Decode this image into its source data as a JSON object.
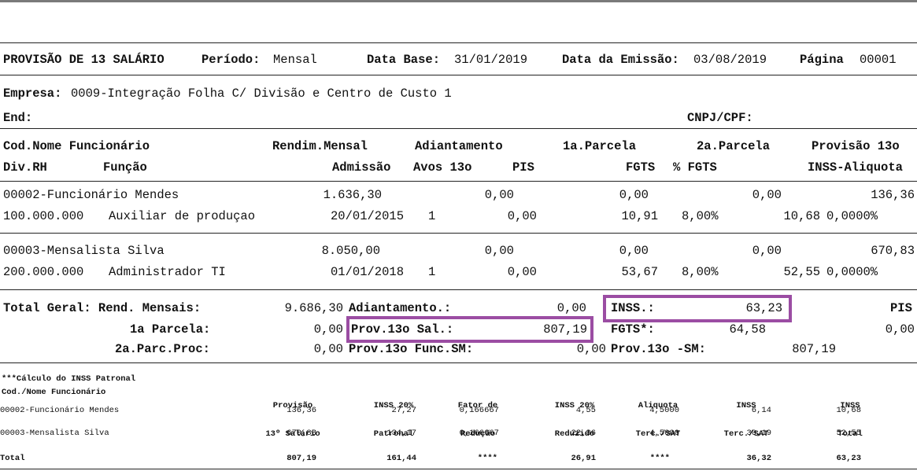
{
  "header": {
    "title": "PROVISÃO DE 13 SALÁRIO",
    "periodo_label": "Período:",
    "periodo_value": "Mensal",
    "data_base_label": "Data Base:",
    "data_base_value": "31/01/2019",
    "emissao_label": "Data da Emissão:",
    "emissao_value": "03/08/2019",
    "pagina_label": "Página",
    "pagina_value": "00001"
  },
  "empresa": {
    "label": "Empresa:",
    "value": "0009-Integração Folha C/ Divisão e Centro de Custo 1",
    "end_label": "End:",
    "cnpj_label": "CNPJ/CPF:"
  },
  "columns": {
    "row1": [
      "Cod.Nome Funcionário",
      "Rendim.Mensal",
      "Adiantamento",
      "1a.Parcela",
      "2a.Parcela",
      "Provisão 13o"
    ],
    "row2": [
      "Div.RH",
      "Função",
      "Admissão",
      "Avos 13o",
      "PIS",
      "FGTS",
      "% FGTS",
      "INSS-Aliquota"
    ]
  },
  "employees": [
    {
      "name": "00002-Funcionário Mendes",
      "rendimento": "1.636,30",
      "adiantamento": "0,00",
      "parcela1": "0,00",
      "parcela2": "0,00",
      "provisao": "136,36",
      "div_rh": "100.000.000",
      "funcao": "Auxiliar de produçao",
      "admissao": "20/01/2015",
      "avos": "1",
      "pis": "0,00",
      "fgts": "10,91",
      "pct_fgts": "8,00%",
      "inss": "10,68",
      "aliquota": "0,0000%"
    },
    {
      "name": "00003-Mensalista Silva",
      "rendimento": "8.050,00",
      "adiantamento": "0,00",
      "parcela1": "0,00",
      "parcela2": "0,00",
      "provisao": "670,83",
      "div_rh": "200.000.000",
      "funcao": "Administrador TI",
      "admissao": "01/01/2018",
      "avos": "1",
      "pis": "0,00",
      "fgts": "53,67",
      "pct_fgts": "8,00%",
      "inss": "52,55",
      "aliquota": "0,0000%"
    }
  ],
  "totals": {
    "rend_label": "Total Geral: Rend. Mensais:",
    "rend_value": "9.686,30",
    "adiant_label": "Adiantamento.:",
    "adiant_value": "0,00",
    "inss_label": "INSS.:",
    "inss_value": "63,23",
    "pis_label": "PIS",
    "parcela1_label": "1a Parcela:",
    "parcela1_value": "0,00",
    "prov_sal_label": "Prov.13o Sal.:",
    "prov_sal_value": "807,19",
    "fgts_label": "FGTS*:",
    "fgts_value": "64,58",
    "pis_value": "0,00",
    "parc2_label": "2a.Parc.Proc:",
    "parc2_value": "0,00",
    "prov_func_label": "Prov.13o Func.SM:",
    "prov_func_value": "0,00",
    "prov_sm_label": "Prov.13o -SM:",
    "prov_sm_value": "807,19"
  },
  "inss_patronal": {
    "title": "***Cálculo do INSS Patronal",
    "name_header": "Cod./Nome Funcionário",
    "headers": [
      [
        "Provisão",
        "13º Salário"
      ],
      [
        "INSS 20%",
        "Patronal"
      ],
      [
        "Fator de",
        "Redução"
      ],
      [
        "INSS 20%",
        "Reduzido"
      ],
      [
        "Aliquota",
        "Terc./SAT"
      ],
      [
        "INSS",
        "Terc./SAT"
      ],
      [
        "INSS",
        "Total"
      ]
    ],
    "rows": [
      {
        "name": "00002-Funcionário Mendes",
        "values": [
          "136,36",
          "27,27",
          "0,166667",
          "4,55",
          "4,5000",
          "6,14",
          "10,68"
        ]
      },
      {
        "name": "00003-Mensalista Silva",
        "values": [
          "670,83",
          "134,17",
          "0,166667",
          "22,36",
          "4,5000",
          "30,19",
          "52,55"
        ]
      }
    ],
    "total": {
      "name": "Total",
      "values": [
        "807,19",
        "161,44",
        "****",
        "26,91",
        "****",
        "36,32",
        "63,23"
      ]
    }
  },
  "highlight_color": "#9b4da3"
}
